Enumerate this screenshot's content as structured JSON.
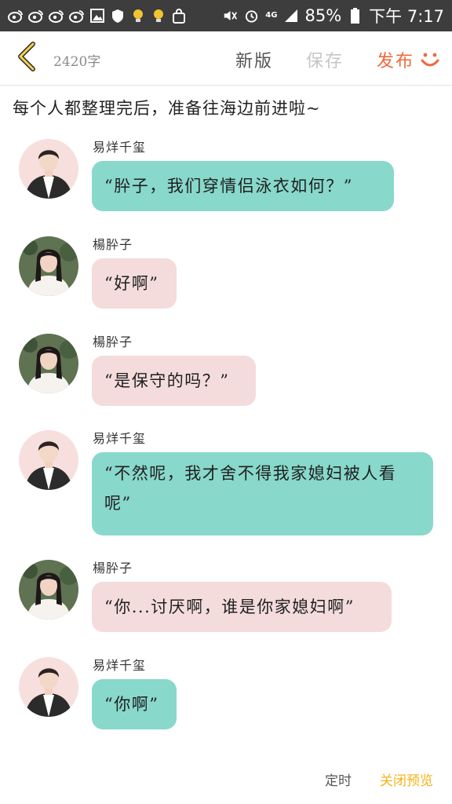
{
  "status_bar": {
    "network": "4G",
    "battery": "85%",
    "time": "下午 7:17",
    "icons": [
      "weibo-icon",
      "weibo-icon",
      "weibo-icon",
      "weibo-icon",
      "image-icon",
      "shield-icon",
      "bulb-icon",
      "bulb-icon",
      "bag-icon",
      "mute-icon",
      "alarm-icon",
      "signal-icon",
      "battery-icon"
    ]
  },
  "top_bar": {
    "word_count": "2420字",
    "new_version": "新版",
    "save": "保存",
    "publish": "发布"
  },
  "narration": "每个人都整理完后，准备往海边前进啦~",
  "messages": [
    {
      "name": "易烊千玺",
      "text": "“肸子，我们穿情侣泳衣如何？”",
      "style": "teal"
    },
    {
      "name": "楊肸子",
      "text": "“好啊”",
      "style": "pink"
    },
    {
      "name": "楊肸子",
      "text": "“是保守的吗？”",
      "style": "pink"
    },
    {
      "name": "易烊千玺",
      "text": "“不然呢，我才舍不得我家媳妇被人看呢”",
      "style": "teal"
    },
    {
      "name": "楊肸子",
      "text": "“你...讨厌啊，谁是你家媳妇啊”",
      "style": "pink"
    },
    {
      "name": "易烊千玺",
      "text": "“你啊”",
      "style": "teal"
    }
  ],
  "footer": {
    "timer": "定时",
    "close_preview": "关闭预览"
  },
  "colors": {
    "teal_bubble": "#88d8cb",
    "pink_bubble": "#f4dcdc",
    "accent_orange": "#ef6a3c",
    "accent_yellow": "#f5b319",
    "status_bar": "#3d3d3d"
  }
}
